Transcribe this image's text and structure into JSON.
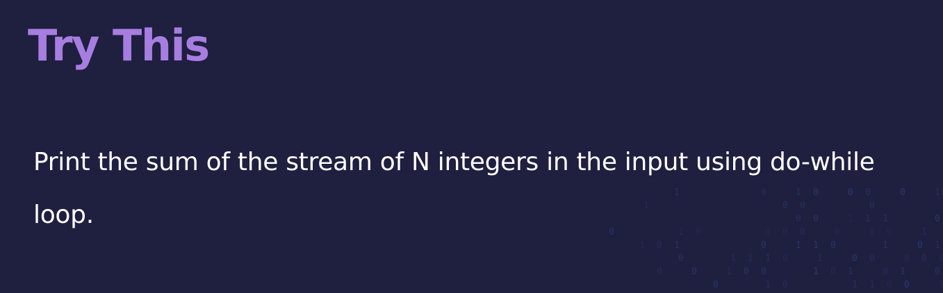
{
  "slide": {
    "title": "Try This",
    "body": "Print the sum of the stream of N integers in the input using do-while loop."
  },
  "colors": {
    "background": "#1f1f40",
    "title": "#a77ee0",
    "body": "#ffffff",
    "binary_pattern": "#2d4a86"
  }
}
